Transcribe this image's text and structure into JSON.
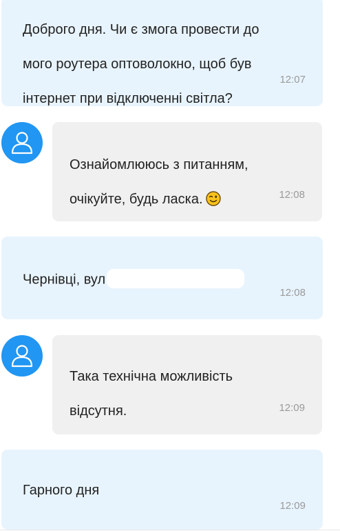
{
  "messages": [
    {
      "sender": "user",
      "lines": [
        "Доброго дня. Чи є змога провести до",
        "мого роутера оптоволокно, щоб був",
        "інтернет при відключенні світла?"
      ],
      "time": "12:07"
    },
    {
      "sender": "agent",
      "lines": [
        "Ознайомлююсь з питанням,",
        "очікуйте, будь ласка."
      ],
      "emoji": "wink-emoji",
      "time": "12:08"
    },
    {
      "sender": "user",
      "lines": [
        "Чернівці, вул"
      ],
      "redacted": true,
      "time": "12:08"
    },
    {
      "sender": "agent",
      "lines": [
        "Така технічна можливість",
        "відсутня."
      ],
      "time": "12:09"
    },
    {
      "sender": "user",
      "lines": [
        "Гарного дня"
      ],
      "time": "12:09"
    }
  ],
  "colors": {
    "user_bubble": "#e8f4fd",
    "agent_bubble": "#f0f0f0",
    "avatar": "#2196f3",
    "timestamp": "#9a9a9a"
  },
  "icons": {
    "avatar": "user-icon"
  }
}
